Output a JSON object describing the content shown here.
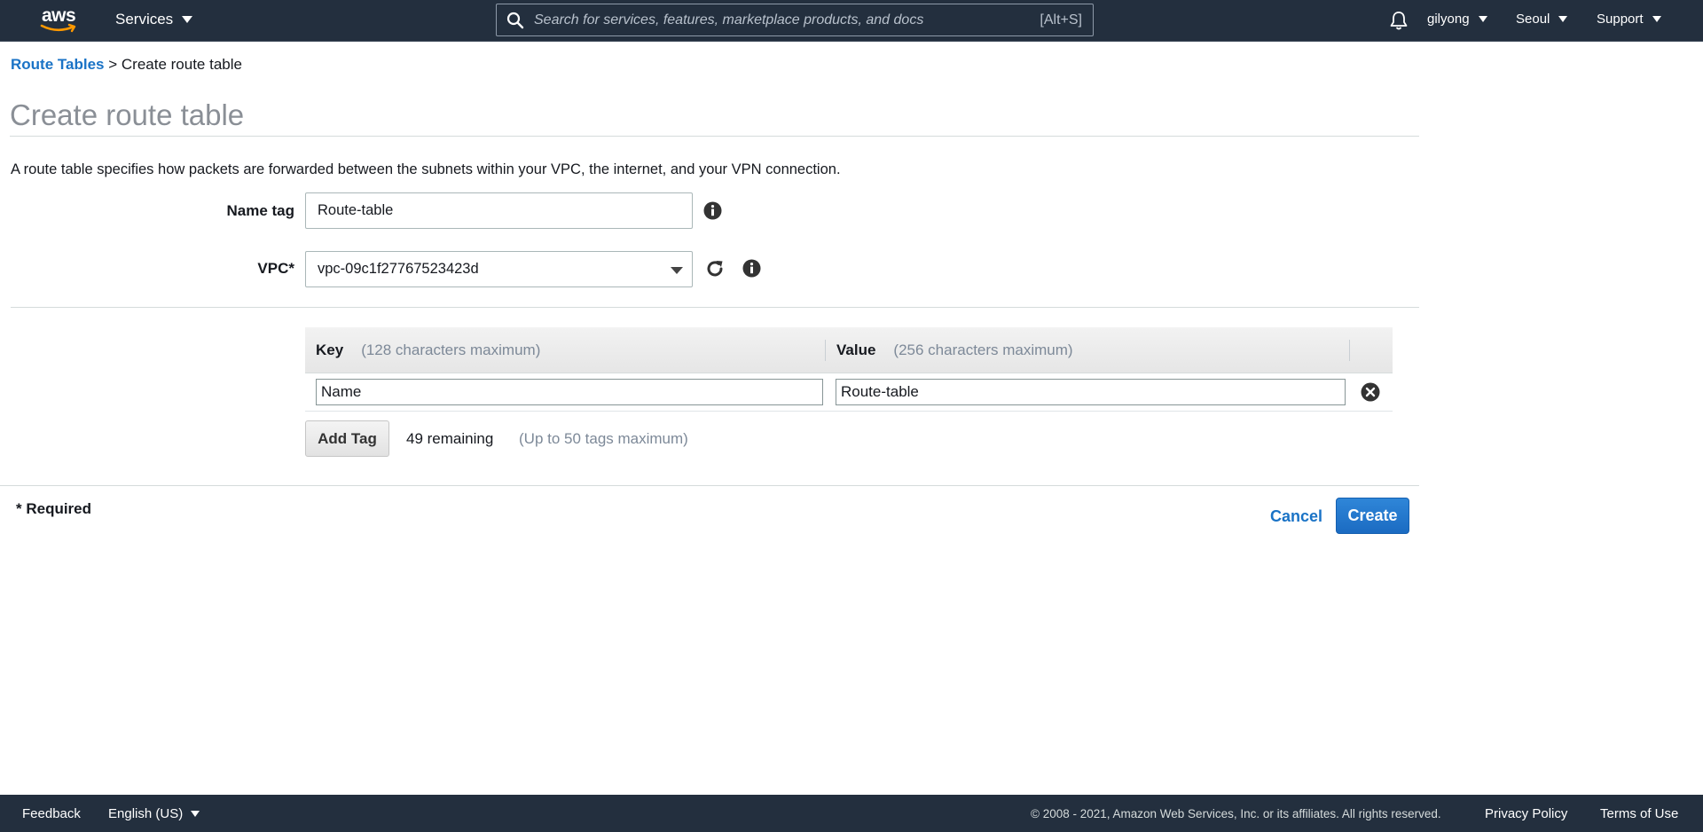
{
  "nav": {
    "logo_text": "aws",
    "services_label": "Services",
    "search_placeholder": "Search for services, features, marketplace products, and docs",
    "search_shortcut": "[Alt+S]",
    "user": "gilyong",
    "region": "Seoul",
    "support": "Support",
    "icons": [
      "search-icon",
      "bell-icon",
      "caret-down-icon"
    ]
  },
  "breadcrumb": {
    "parent": "Route Tables",
    "separator": ">",
    "current": "Create route table"
  },
  "page": {
    "title": "Create route table",
    "description": "A route table specifies how packets are forwarded between the subnets within your VPC, the internet, and your VPN connection."
  },
  "form": {
    "name_tag_label": "Name tag",
    "name_tag_value": "Route-table",
    "vpc_label": "VPC*",
    "vpc_value": "vpc-09c1f27767523423d"
  },
  "tags": {
    "key_header": "Key",
    "key_hint": "(128 characters maximum)",
    "value_header": "Value",
    "value_hint": "(256 characters maximum)",
    "rows": [
      {
        "key": "Name",
        "value": "Route-table"
      }
    ],
    "add_tag_label": "Add Tag",
    "remaining": "49 remaining",
    "max_hint": "(Up to 50 tags maximum)"
  },
  "actions": {
    "required_note": "* Required",
    "cancel_label": "Cancel",
    "create_label": "Create"
  },
  "footer": {
    "feedback": "Feedback",
    "language": "English (US)",
    "copyright": "© 2008 - 2021, Amazon Web Services, Inc. or its affiliates. All rights reserved.",
    "privacy": "Privacy Policy",
    "terms": "Terms of Use"
  },
  "colors": {
    "nav_bg": "#232f3e",
    "link": "#1a73c6",
    "primary_button": "#1b6bc2",
    "logo_smile": "#ff9900"
  }
}
